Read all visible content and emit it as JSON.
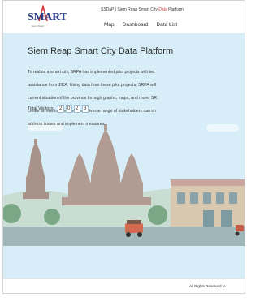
{
  "header": {
    "logo_text": "SMART",
    "logo_subtext": "Siem Reap",
    "site_name_prefix": "SSDaP | Siem Reap Smart City ",
    "site_name_accent": "Data",
    "site_name_suffix": " Platform",
    "nav": [
      "Map",
      "Dashboard",
      "Data List"
    ]
  },
  "hero": {
    "title": "Siem Reap Smart City Data Platform",
    "description_lines": [
      "To realize a smart city, SRPA has implemented pilot projects with tec",
      "assistance from JICA. Using data from these pilot projects, SRPA will",
      "current situation of the province through graphs, maps, and more. SR",
      "create an environment where a diverse range of stakeholders can sh",
      "address issues and implement measures."
    ],
    "visitors_label": "Total Visitors:",
    "visitor_digits": [
      "2",
      "0",
      "2",
      "3"
    ]
  },
  "footer": {
    "copyright": "All Rights Reserved to"
  },
  "colors": {
    "sky": "#d7edf7",
    "temple": "#a9928a",
    "ground": "#b9d2c2",
    "brand_blue": "#2d3f8a",
    "brand_red": "#d23b3b"
  }
}
